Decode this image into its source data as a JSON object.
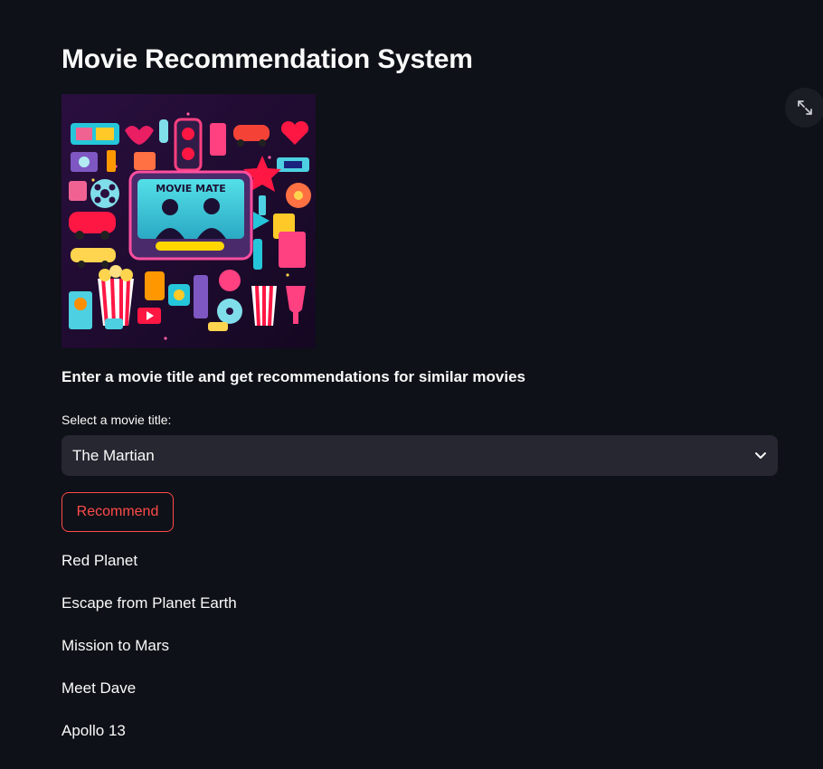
{
  "page": {
    "title": "Movie Recommendation System"
  },
  "poster": {
    "text": "MOVIE MATE"
  },
  "main": {
    "subtitle": "Enter a movie title and get recommendations for similar movies",
    "select_label": "Select a movie title:",
    "selected_movie": "The Martian",
    "recommend_label": "Recommend"
  },
  "recommendations": [
    "Red Planet",
    "Escape from Planet Earth",
    "Mission to Mars",
    "Meet Dave",
    "Apollo 13"
  ],
  "colors": {
    "background": "#0e1117",
    "text": "#fafafa",
    "accent": "#ff4b4b",
    "select_bg": "#262730"
  },
  "icons": {
    "expand": "expand-icon",
    "dropdown": "chevron-down-icon"
  }
}
